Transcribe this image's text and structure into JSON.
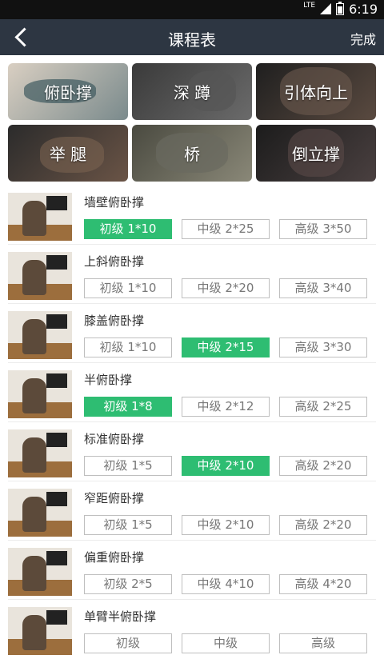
{
  "status_bar": {
    "network": "LTE",
    "time": "6:19"
  },
  "nav": {
    "title": "课程表",
    "done": "完成"
  },
  "categories": [
    "俯卧撑",
    "深 蹲",
    "引体向上",
    "举 腿",
    "桥",
    "倒立撑"
  ],
  "exercises": [
    {
      "name": "墙壁俯卧撑",
      "levels": [
        "初级 1*10",
        "中级 2*25",
        "高级 3*50"
      ],
      "selected": 0
    },
    {
      "name": "上斜俯卧撑",
      "levels": [
        "初级 1*10",
        "中级 2*20",
        "高级 3*40"
      ],
      "selected": -1
    },
    {
      "name": "膝盖俯卧撑",
      "levels": [
        "初级 1*10",
        "中级 2*15",
        "高级 3*30"
      ],
      "selected": 1
    },
    {
      "name": "半俯卧撑",
      "levels": [
        "初级 1*8",
        "中级 2*12",
        "高级 2*25"
      ],
      "selected": 0
    },
    {
      "name": "标准俯卧撑",
      "levels": [
        "初级 1*5",
        "中级 2*10",
        "高级 2*20"
      ],
      "selected": 1
    },
    {
      "name": "窄距俯卧撑",
      "levels": [
        "初级 1*5",
        "中级 2*10",
        "高级 2*20"
      ],
      "selected": -1
    },
    {
      "name": "偏重俯卧撑",
      "levels": [
        "初级 2*5",
        "中级 4*10",
        "高级 4*20"
      ],
      "selected": -1
    },
    {
      "name": "单臂半俯卧撑",
      "levels": [
        "初级",
        "中级",
        "高级"
      ],
      "selected": -1
    }
  ],
  "colors": {
    "nav_bg": "#2d3642",
    "selected": "#2ebd72"
  }
}
